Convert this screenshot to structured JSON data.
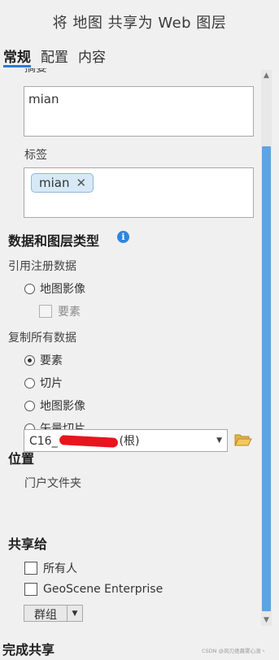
{
  "title": "将 地图 共享为 Web 图层",
  "tabs": [
    "常规",
    "配置",
    "内容"
  ],
  "summary": {
    "label": "摘要",
    "value": "mian"
  },
  "tags": {
    "label": "标签",
    "chips": [
      "mian"
    ]
  },
  "data_layer_type": {
    "heading": "数据和图层类型",
    "reference_label": "引用注册数据",
    "reference_options": [
      {
        "label": "地图影像",
        "checked": false
      },
      {
        "label": "要素",
        "checked": false,
        "disabled": true
      }
    ],
    "copy_label": "复制所有数据",
    "copy_options": [
      {
        "label": "要素",
        "checked": true
      },
      {
        "label": "切片",
        "checked": false
      },
      {
        "label": "地图影像",
        "checked": false
      },
      {
        "label": "矢量切片",
        "checked": false
      }
    ]
  },
  "location": {
    "heading": "位置",
    "folder_label": "门户文件夹",
    "folder_value_prefix": "C16_",
    "folder_value_suffix": "(根)"
  },
  "share_with": {
    "heading": "共享给",
    "options": [
      {
        "label": "所有人",
        "checked": false
      },
      {
        "label": "GeoScene Enterprise",
        "checked": false
      }
    ],
    "group_button": "群组"
  },
  "finish_heading": "完成共享",
  "watermark": "CSDN @风刃绝晨雾心涨丶",
  "colors": {
    "accent": "#2b7bd6",
    "scroll_thumb": "#5ea4e2",
    "info": "#2e86de",
    "tag_chip_bg": "#d7e9f7"
  }
}
